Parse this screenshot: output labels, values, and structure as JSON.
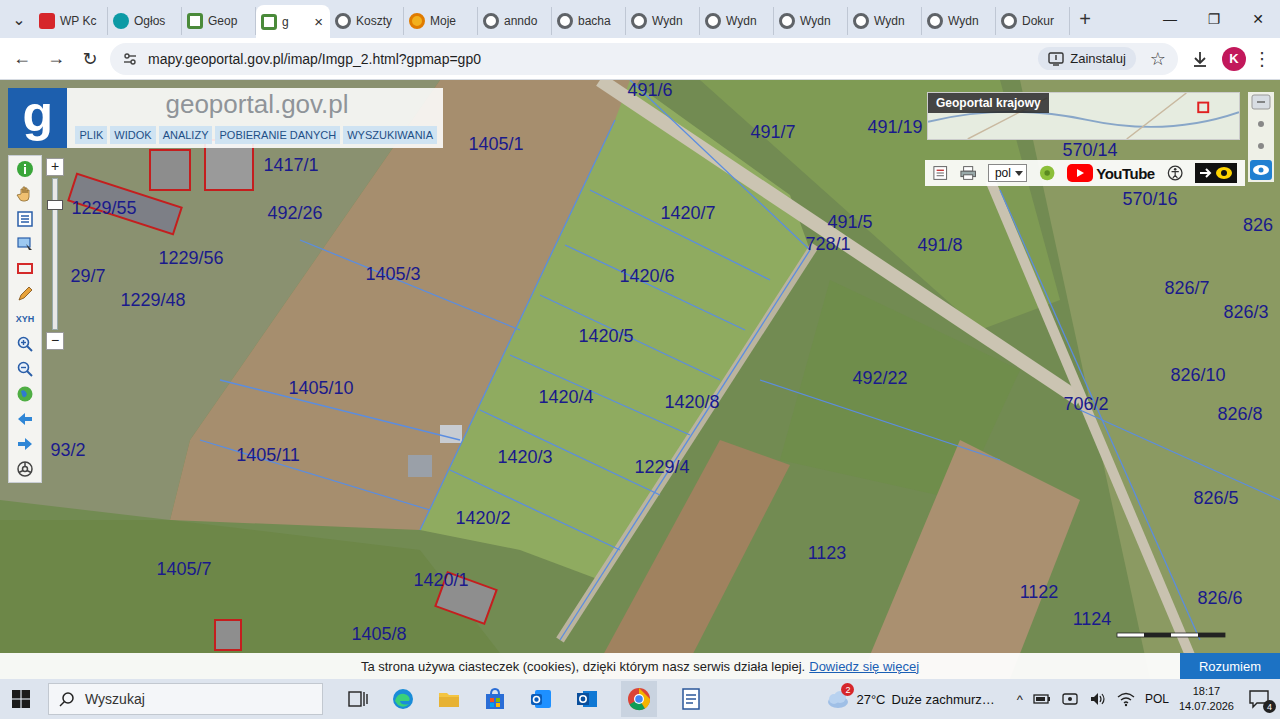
{
  "browser": {
    "tab_search": "⌄",
    "tabs": [
      {
        "label": "WP Kc",
        "selected": false
      },
      {
        "label": "Ogłos",
        "selected": false
      },
      {
        "label": "Geop",
        "selected": false
      },
      {
        "label": "g",
        "selected": true
      },
      {
        "label": "Koszty",
        "selected": false
      },
      {
        "label": "Moje",
        "selected": false
      },
      {
        "label": "anndo",
        "selected": false
      },
      {
        "label": "bacha",
        "selected": false
      },
      {
        "label": "Wydn",
        "selected": false
      },
      {
        "label": "Wydn",
        "selected": false
      },
      {
        "label": "Wydn",
        "selected": false
      },
      {
        "label": "Wydn",
        "selected": false
      },
      {
        "label": "Wydn",
        "selected": false
      },
      {
        "label": "Dokur",
        "selected": false
      }
    ],
    "tab_close": "×",
    "new_tab": "+",
    "window_controls": [
      "—",
      "❐",
      "✕"
    ],
    "nav": [
      "←",
      "→",
      "↻"
    ],
    "url": "mapy.geoportal.gov.pl/imap/Imgp_2.html?gpmap=gp0",
    "install": "Zainstaluj",
    "bookmark": "☆",
    "avatar": "K",
    "menu": "⋮"
  },
  "geoportal": {
    "logo_letter": "g",
    "title": "geoportal.gov.pl",
    "menu": [
      "PLIK",
      "WIDOK",
      "ANALIZY",
      "POBIERANIE DANYCH",
      "WYSZUKIWANIA"
    ]
  },
  "tools": {
    "zoom_in": "+",
    "zoom_out": "−",
    "zoom_level": 0.85,
    "coordinates_label": "XYH"
  },
  "overview": {
    "title": "Geoportal krajowy"
  },
  "map_toolbar": {
    "language": "pol",
    "youtube": "YouTube"
  },
  "parcels": [
    {
      "label": "491/6"
    },
    {
      "label": "1405/1"
    },
    {
      "label": "491/7"
    },
    {
      "label": "491/19"
    },
    {
      "label": "570/14"
    },
    {
      "label": "570/16"
    },
    {
      "label": "1417/1"
    },
    {
      "label": "1229/55"
    },
    {
      "label": "492/26"
    },
    {
      "label": "1420/7"
    },
    {
      "label": "491/5"
    },
    {
      "label": "728/1"
    },
    {
      "label": "491/8"
    },
    {
      "label": "826"
    },
    {
      "label": "1229/56"
    },
    {
      "label": "1405/3"
    },
    {
      "label": "1420/6"
    },
    {
      "label": "29/7"
    },
    {
      "label": "826/7"
    },
    {
      "label": "826/3"
    },
    {
      "label": "1229/48"
    },
    {
      "label": "1420/5"
    },
    {
      "label": "492/22"
    },
    {
      "label": "826/10"
    },
    {
      "label": "1405/10"
    },
    {
      "label": "1420/4"
    },
    {
      "label": "1420/8"
    },
    {
      "label": "706/2"
    },
    {
      "label": "826/8"
    },
    {
      "label": "93/2"
    },
    {
      "label": "1405/11"
    },
    {
      "label": "1420/3"
    },
    {
      "label": "1229/4"
    },
    {
      "label": "826/5"
    },
    {
      "label": "1420/2"
    },
    {
      "label": "1123"
    },
    {
      "label": "1405/7"
    },
    {
      "label": "1420/1"
    },
    {
      "label": "1122"
    },
    {
      "label": "826/6"
    },
    {
      "label": "1124"
    },
    {
      "label": "1405/8"
    }
  ],
  "cookie_banner": {
    "text": "Ta strona używa ciasteczek (cookies), dzięki którym nasz serwis działa lepiej.",
    "link": "Dowiedz się więcej",
    "button": "Rozumiem"
  },
  "taskbar": {
    "search": "Wyszukaj",
    "weather_badge": "2",
    "temperature": "27°C",
    "weather": "Duże zachmurz…",
    "tray_chevron": "^",
    "language": "POL",
    "time": "18:17",
    "date": "14.07.2026",
    "notifications": "4"
  }
}
